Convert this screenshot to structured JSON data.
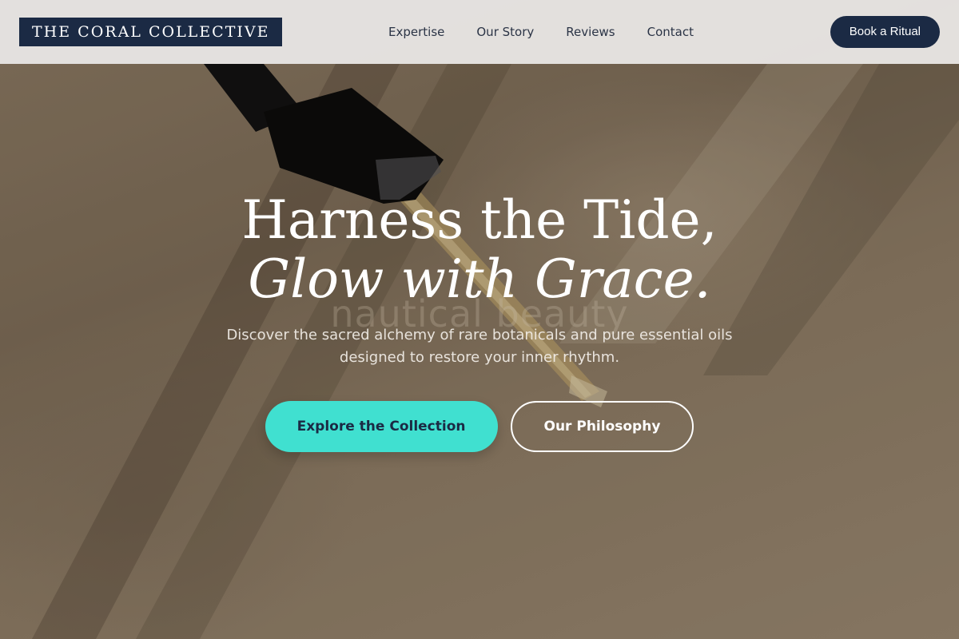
{
  "brand": {
    "logo_text": "THE CORAL COLLECTIVE"
  },
  "nav": {
    "links": [
      {
        "label": "Expertise"
      },
      {
        "label": "Our Story"
      },
      {
        "label": "Reviews"
      },
      {
        "label": "Contact"
      }
    ],
    "cta_label": "Book a Ritual"
  },
  "hero": {
    "headline_line1": "Harness the Tide,",
    "headline_line2": "Glow with Grace.",
    "watermark_text": "nautical beauty",
    "subtext_line1": "Discover the sacred alchemy of rare botanicals and pure essential oils",
    "subtext_line2": "designed to restore your inner rhythm.",
    "primary_cta": "Explore the Collection",
    "secondary_cta": "Our Philosophy",
    "image_subject": "dropper-bottle-photo"
  },
  "colors": {
    "navy": "#1b2a44",
    "turquoise": "#40e0d0",
    "nav_bg": "#eceae8",
    "sand": "#8c7a64"
  }
}
